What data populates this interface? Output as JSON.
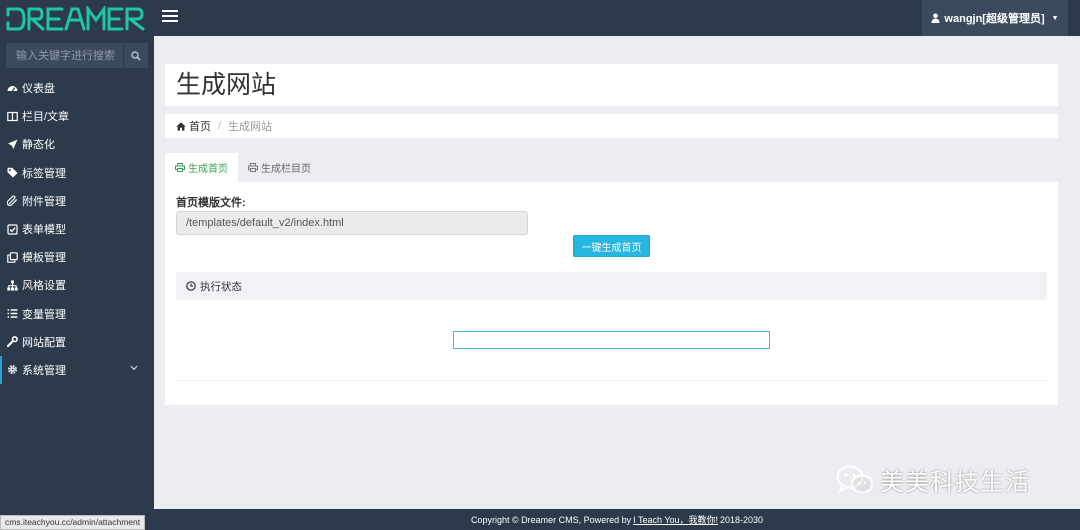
{
  "brand": {
    "logo_text": "DREAMER"
  },
  "header": {
    "user_name": "wangjn[超级管理员]"
  },
  "sidebar": {
    "search_placeholder": "输入关键字进行搜索",
    "items": [
      {
        "label": "仪表盘",
        "icon": "dashboard-icon"
      },
      {
        "label": "栏目/文章",
        "icon": "columns-icon"
      },
      {
        "label": "静态化",
        "icon": "rocket-icon"
      },
      {
        "label": "标签管理",
        "icon": "tags-icon"
      },
      {
        "label": "附件管理",
        "icon": "paperclip-icon"
      },
      {
        "label": "表单模型",
        "icon": "checkbox-icon"
      },
      {
        "label": "模板管理",
        "icon": "clone-icon"
      },
      {
        "label": "风格设置",
        "icon": "sitemap-icon"
      },
      {
        "label": "变量管理",
        "icon": "list-icon"
      },
      {
        "label": "网站配置",
        "icon": "wrench-icon"
      },
      {
        "label": "系统管理",
        "icon": "gear-icon"
      }
    ]
  },
  "page": {
    "title": "生成网站",
    "breadcrumb": {
      "home": "首页",
      "current": "生成网站"
    },
    "tabs": [
      {
        "label": "生成首页",
        "active": true
      },
      {
        "label": "生成栏目页",
        "active": false
      }
    ],
    "template_label": "首页模版文件:",
    "template_value": "/templates/default_v2/index.html",
    "generate_button": "一键生成首页",
    "status_title": "执行状态",
    "progress": 0
  },
  "footer": {
    "prefix": "Copyright © Dreamer CMS, Powered by",
    "link": "I Teach You，我教你!",
    "years": "2018-2030"
  },
  "status_url": "cms.iteachyou.cc/admin/attachment",
  "watermark": "美美科技生活",
  "colors": {
    "sidebar_bg": "#2c3a4c",
    "accent": "#27b6e0",
    "active_tab": "#3ca14f"
  }
}
